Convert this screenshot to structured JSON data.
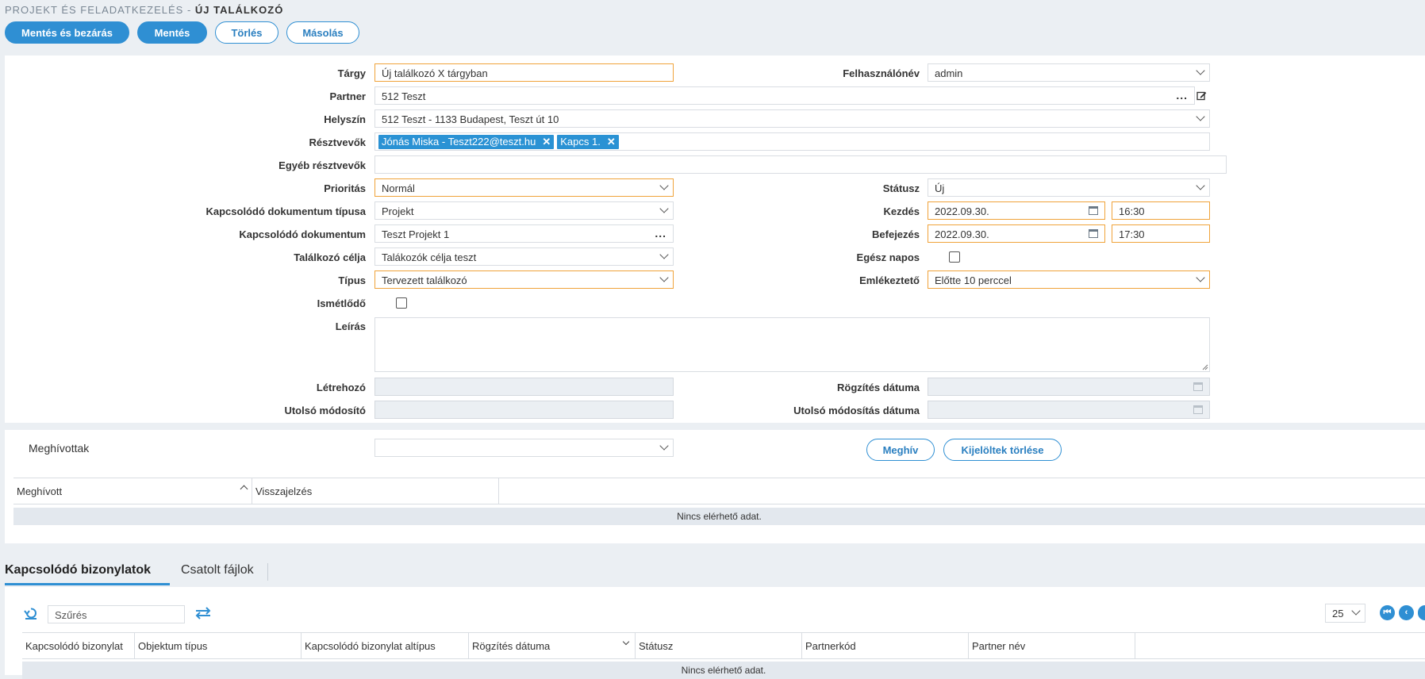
{
  "breadcrumb": {
    "section": "PROJEKT ÉS FELADATKEZELÉS - ",
    "page": "ÚJ TALÁLKOZÓ"
  },
  "toolbar": {
    "save_close": "Mentés és bezárás",
    "save": "Mentés",
    "delete": "Törlés",
    "copy": "Másolás"
  },
  "form": {
    "subject": {
      "label": "Tárgy",
      "value": "Új találkozó X tárgyban"
    },
    "username": {
      "label": "Felhasználónév",
      "value": "admin"
    },
    "partner": {
      "label": "Partner",
      "value": "512 Teszt"
    },
    "location": {
      "label": "Helyszín",
      "value": "512 Teszt - 1133 Budapest, Teszt út 10"
    },
    "participants": {
      "label": "Résztvevők",
      "chips": [
        "Jónás Miska - Teszt222@teszt.hu",
        "Kapcs 1."
      ]
    },
    "other_participants": {
      "label": "Egyéb résztvevők",
      "value": ""
    },
    "priority": {
      "label": "Prioritás",
      "value": "Normál"
    },
    "status": {
      "label": "Státusz",
      "value": "Új"
    },
    "doc_type": {
      "label": "Kapcsolódó dokumentum típusa",
      "value": "Projekt"
    },
    "start": {
      "label": "Kezdés",
      "date": "2022.09.30.",
      "time": "16:30"
    },
    "doc": {
      "label": "Kapcsolódó dokumentum",
      "value": "Teszt Projekt 1"
    },
    "end": {
      "label": "Befejezés",
      "date": "2022.09.30.",
      "time": "17:30"
    },
    "goal": {
      "label": "Találkozó célja",
      "value": "Talákozók célja teszt"
    },
    "all_day": {
      "label": "Egész napos",
      "checked": false
    },
    "type": {
      "label": "Típus",
      "value": "Tervezett találkozó"
    },
    "reminder": {
      "label": "Emlékeztető",
      "value": "Előtte 10 perccel"
    },
    "recurring": {
      "label": "Ismétlődő",
      "checked": false
    },
    "description": {
      "label": "Leírás",
      "value": ""
    },
    "creator": {
      "label": "Létrehozó",
      "value": ""
    },
    "record_date": {
      "label": "Rögzítés dátuma",
      "value": ""
    },
    "last_modifier": {
      "label": "Utolsó módosító",
      "value": ""
    },
    "last_modified_date": {
      "label": "Utolsó módosítás dátuma",
      "value": ""
    }
  },
  "invited": {
    "label": "Meghívottak",
    "select_value": "",
    "invite_button": "Meghív",
    "delete_selected_button": "Kijelöltek törlése",
    "columns": [
      "Meghívott",
      "Visszajelzés"
    ],
    "empty_text": "Nincs elérhető adat."
  },
  "tabs": {
    "related": "Kapcsolódó bizonylatok",
    "files": "Csatolt fájlok"
  },
  "related_grid": {
    "filter_placeholder": "Szűrés",
    "page_size": "25",
    "columns": [
      "Kapcsolódó bizonylat",
      "Objektum típus",
      "Kapcsolódó bizonylat altípus",
      "Rögzítés dátuma",
      "Státusz",
      "Partnerkód",
      "Partner név"
    ],
    "empty_text": "Nincs elérhető adat."
  },
  "colors": {
    "accent": "#2f8fd3",
    "required_border": "#f0a33a",
    "background": "#ebeff3"
  }
}
